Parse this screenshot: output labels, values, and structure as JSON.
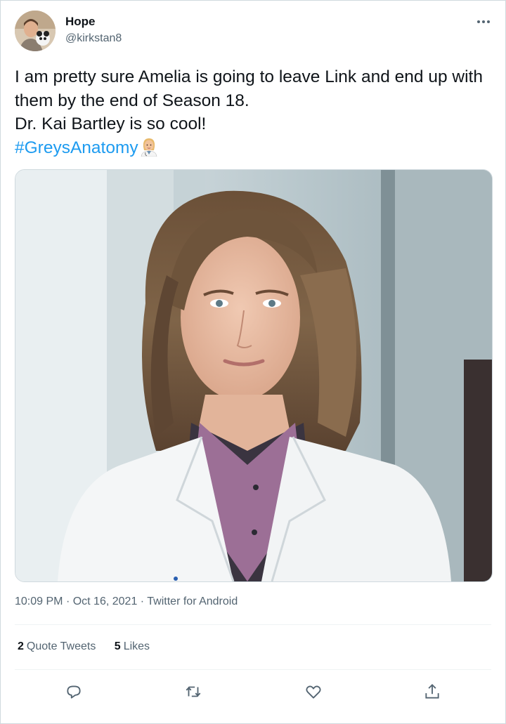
{
  "author": {
    "display_name": "Hope",
    "handle": "@kirkstan8"
  },
  "tweet": {
    "line1": "I am pretty sure Amelia is going to leave Link and end up with them by the end of Season 18.",
    "line2": "Dr. Kai Bartley is so cool!",
    "hashtag": "#GreysAnatomy",
    "emoji": "woman-health-worker-emoji"
  },
  "meta": {
    "time": "10:09 PM",
    "separator": "·",
    "date": "Oct 16, 2021",
    "source": "Twitter for Android"
  },
  "stats": {
    "quote_tweets_count": "2",
    "quote_tweets_label": "Quote Tweets",
    "likes_count": "5",
    "likes_label": "Likes"
  },
  "actions": [
    "reply-icon",
    "retweet-icon",
    "like-icon",
    "share-icon"
  ],
  "colors": {
    "link": "#1d9bf0",
    "secondary_text": "#536471",
    "border": "#cfd9de"
  }
}
